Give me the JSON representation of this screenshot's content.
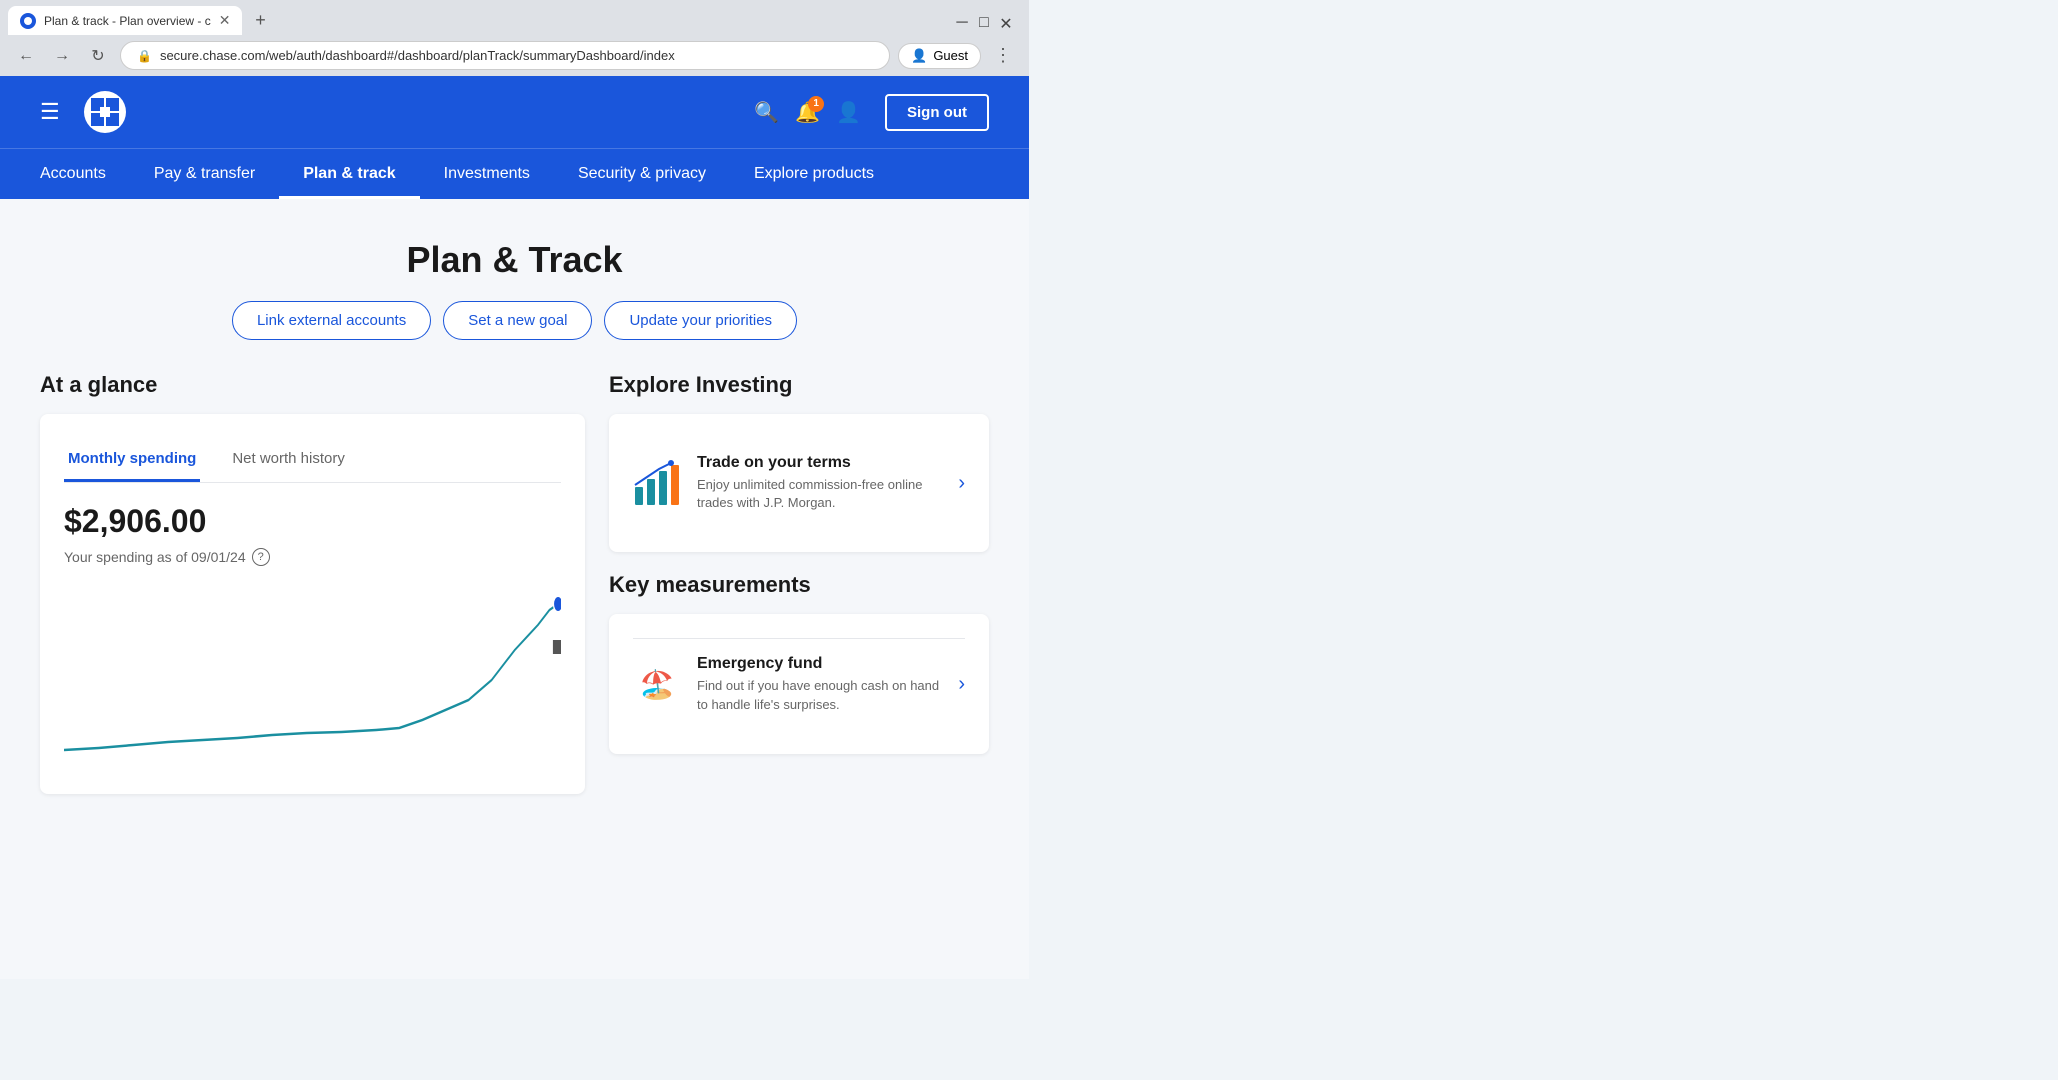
{
  "browser": {
    "tab_favicon": "🔵",
    "tab_title": "Plan & track - Plan overview - c",
    "new_tab_label": "+",
    "window_minimize": "─",
    "window_maximize": "□",
    "window_close": "✕",
    "back_icon": "←",
    "forward_icon": "→",
    "reload_icon": "↻",
    "address_url": "secure.chase.com/web/auth/dashboard#/dashboard/planTrack/summaryDashboard/index",
    "profile_label": "Guest",
    "menu_icon": "⋮"
  },
  "nav": {
    "hamburger_icon": "☰",
    "logo_alt": "Chase",
    "notification_count": "1",
    "sign_out_label": "Sign out",
    "items": [
      {
        "label": "Accounts",
        "active": false
      },
      {
        "label": "Pay & transfer",
        "active": false
      },
      {
        "label": "Plan & track",
        "active": true
      },
      {
        "label": "Investments",
        "active": false
      },
      {
        "label": "Security & privacy",
        "active": false
      },
      {
        "label": "Explore products",
        "active": false
      }
    ]
  },
  "page": {
    "title": "Plan & Track",
    "action_buttons": [
      {
        "label": "Link external accounts"
      },
      {
        "label": "Set a new goal"
      },
      {
        "label": "Update your priorities"
      }
    ]
  },
  "at_a_glance": {
    "section_title": "At a glance",
    "tabs": [
      {
        "label": "Monthly spending",
        "active": true
      },
      {
        "label": "Net worth history",
        "active": false
      }
    ],
    "spending_amount": "$2,906.00",
    "spending_subtitle": "Your spending as of 09/01/24",
    "help_icon": "?"
  },
  "explore_investing": {
    "section_title": "Explore Investing",
    "items": [
      {
        "title": "Trade on your terms",
        "description": "Enjoy unlimited commission-free online trades with J.P. Morgan."
      }
    ]
  },
  "key_measurements": {
    "section_title": "Key measurements",
    "items": [
      {
        "title": "Emergency fund",
        "description": "Find out if you have enough cash on hand to handle life's surprises.",
        "icon": "🏖️"
      }
    ]
  },
  "colors": {
    "primary_blue": "#1a56db",
    "chart_line": "#1a8fa0",
    "chart_dot": "#1a56db"
  }
}
